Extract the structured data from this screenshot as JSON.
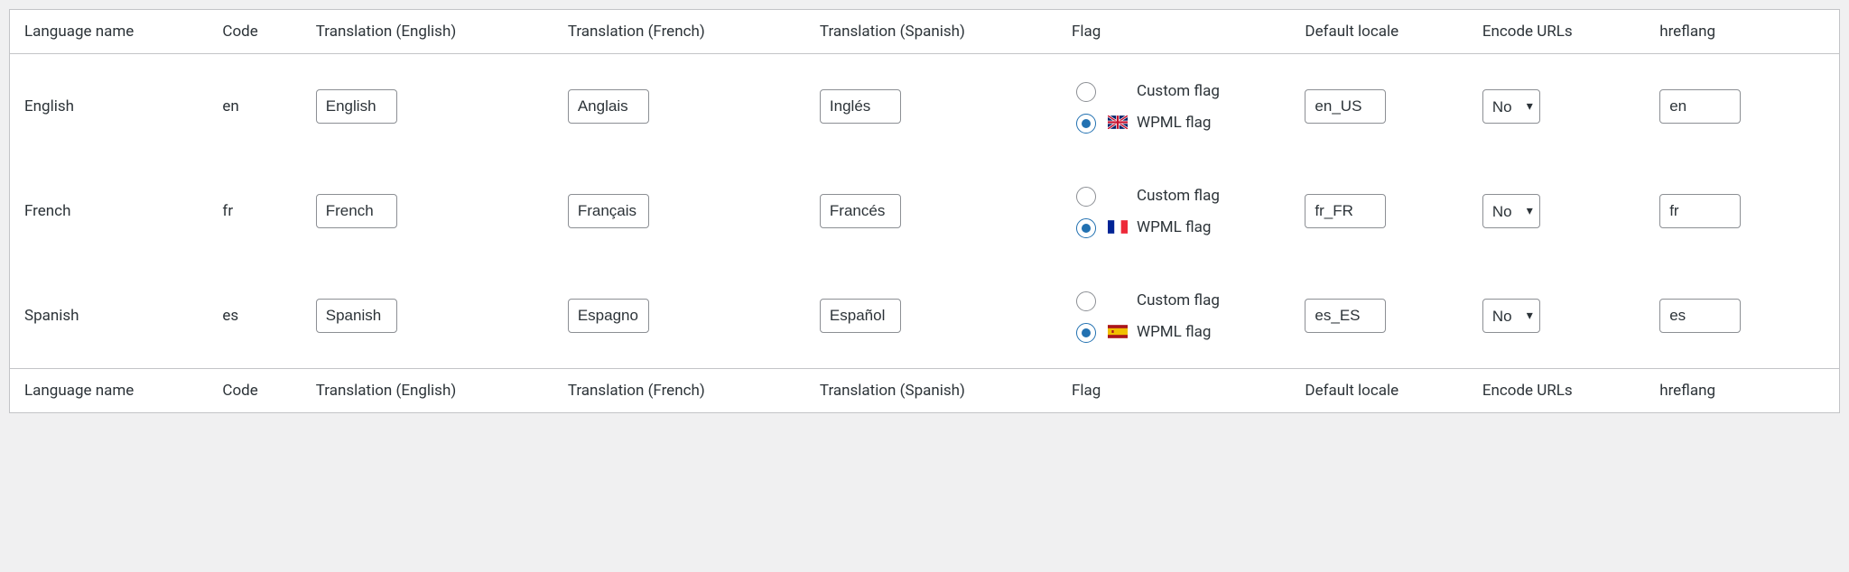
{
  "columns": {
    "name": "Language name",
    "code": "Code",
    "trans_en": "Translation (English)",
    "trans_fr": "Translation (French)",
    "trans_es": "Translation (Spanish)",
    "flag": "Flag",
    "locale": "Default locale",
    "encode": "Encode URLs",
    "hreflang": "hreflang"
  },
  "flag_labels": {
    "custom": "Custom flag",
    "wpml": "WPML flag"
  },
  "encode_options": {
    "no": "No"
  },
  "rows": [
    {
      "name": "English",
      "code": "en",
      "trans_en": "English",
      "trans_fr": "Anglais",
      "trans_es": "Inglés",
      "flag_selected": "wpml",
      "flag_icon": "gb",
      "locale": "en_US",
      "encode": "No",
      "hreflang": "en"
    },
    {
      "name": "French",
      "code": "fr",
      "trans_en": "French",
      "trans_fr": "Français",
      "trans_es": "Francés",
      "flag_selected": "wpml",
      "flag_icon": "fr",
      "locale": "fr_FR",
      "encode": "No",
      "hreflang": "fr"
    },
    {
      "name": "Spanish",
      "code": "es",
      "trans_en": "Spanish",
      "trans_fr": "Espagnol",
      "trans_es": "Español",
      "flag_selected": "wpml",
      "flag_icon": "es",
      "locale": "es_ES",
      "encode": "No",
      "hreflang": "es"
    }
  ]
}
